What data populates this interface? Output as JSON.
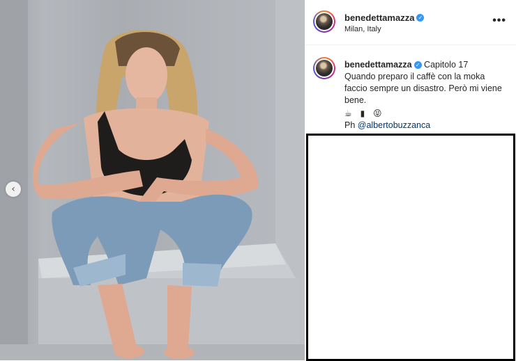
{
  "post": {
    "username": "benedettamazza",
    "location": "Milan, Italy",
    "caption": {
      "first_line": "Capitolo 17",
      "body": "Quando preparo il caffè con la moka faccio sempre un disastro. Però mi viene bene.",
      "emojis": "☕ ▮ 😝",
      "credit_prefix": "Ph",
      "credit_mention": "@albertobuzzanca"
    }
  },
  "icons": {
    "verified": "verified-badge-icon",
    "more": "more-options-icon",
    "prev": "chevron-left-icon"
  },
  "glyphs": {
    "verified": "✓",
    "more": "•••",
    "prev": "‹"
  },
  "colors": {
    "verified": "#3897f0",
    "mention": "#00376b",
    "text": "#262626"
  }
}
